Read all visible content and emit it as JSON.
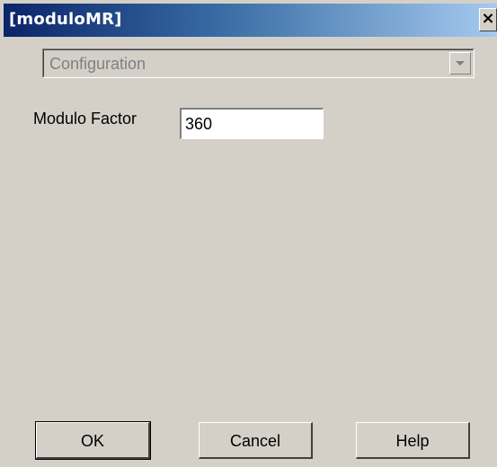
{
  "window": {
    "title": "[moduloMR]",
    "close_glyph": "×",
    "close_icon": "close-icon"
  },
  "config_combo": {
    "selected": "Configuration",
    "enabled": false,
    "arrow_icon": "chevron-down-icon"
  },
  "modulo": {
    "label": "Modulo Factor",
    "value": "360"
  },
  "buttons": {
    "ok": "OK",
    "cancel": "Cancel",
    "help": "Help"
  },
  "colors": {
    "titlebar_start": "#0a246a",
    "titlebar_end": "#a6caf0",
    "face": "#d4d0c8"
  }
}
